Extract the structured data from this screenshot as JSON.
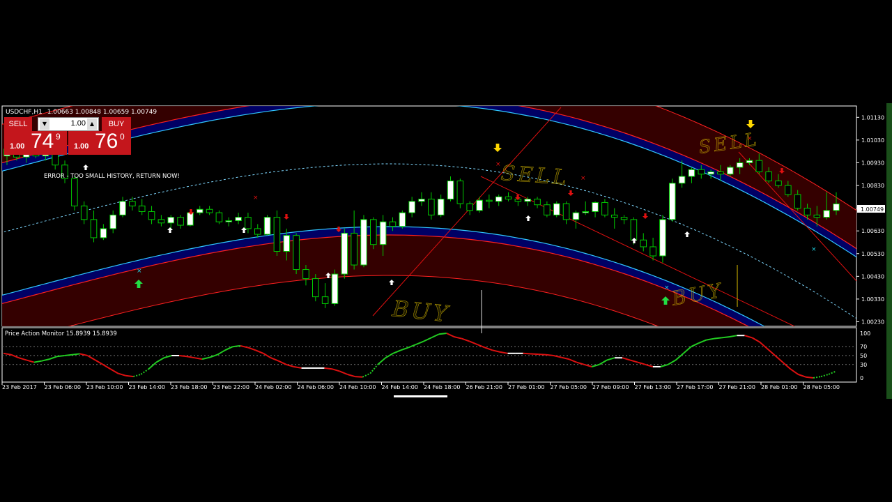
{
  "symbol_header": "USDCHF,H1",
  "ohlc_header": "1.00663 1.00848 1.00659 1.00749",
  "trade_panel": {
    "sell_label": "SELL",
    "buy_label": "BUY",
    "lots_value": "1.00",
    "sell_lots": "1.00",
    "sell_price_big": "74",
    "sell_price_sup": "9",
    "buy_lots": "1.00",
    "buy_price_big": "76",
    "buy_price_sup": "0"
  },
  "error_message": "ERROR - TOO SMALL HISTORY, RETURN NOW!",
  "indicator_header": "Price Action Monitor 15.8939 15.8939",
  "current_price_label": "1.00749",
  "annotations": {
    "sell_1": "SELL",
    "sell_2": "SELL",
    "buy_1": "BUY",
    "buy_2": "BUY"
  },
  "colors": {
    "background": "#000000",
    "bull_candle": "#ffffff",
    "bear_candle": "#000000",
    "candle_outline": "#00cc00",
    "band_fill": "#3a0000",
    "band_red": "#ff2020",
    "band_blue": "#000070",
    "band_cyan": "#30c8ff",
    "osc_up": "#22cc22",
    "osc_down": "#dd1111",
    "handwriting": "#e0c000"
  },
  "chart_data": [
    {
      "type": "candlestick",
      "title": "USDCHF,H1",
      "y_ticks": [
        "1.01130",
        "1.01030",
        "1.00930",
        "1.00830",
        "1.00730",
        "1.00630",
        "1.00530",
        "1.00430",
        "1.00330",
        "1.00230"
      ],
      "ylim": [
        1.0021,
        1.0118
      ],
      "x_ticks": [
        "23 Feb 2017",
        "23 Feb 06:00",
        "23 Feb 10:00",
        "23 Feb 14:00",
        "23 Feb 18:00",
        "23 Feb 22:00",
        "24 Feb 02:00",
        "24 Feb 06:00",
        "24 Feb 10:00",
        "24 Feb 14:00",
        "24 Feb 18:00",
        "26 Feb 21:00",
        "27 Feb 01:00",
        "27 Feb 05:00",
        "27 Feb 09:00",
        "27 Feb 13:00",
        "27 Feb 17:00",
        "27 Feb 21:00",
        "28 Feb 01:00",
        "28 Feb 05:00"
      ],
      "candles": [
        {
          "o": 1.0096,
          "h": 1.0101,
          "l": 1.0092,
          "c": 1.0099
        },
        {
          "o": 1.0099,
          "h": 1.01,
          "l": 1.0094,
          "c": 1.00955
        },
        {
          "o": 1.00955,
          "h": 1.0099,
          "l": 1.0093,
          "c": 1.00975
        },
        {
          "o": 1.00975,
          "h": 1.00995,
          "l": 1.0095,
          "c": 1.0096
        },
        {
          "o": 1.0096,
          "h": 1.0099,
          "l": 1.0094,
          "c": 1.00975
        },
        {
          "o": 1.00975,
          "h": 1.0098,
          "l": 1.009,
          "c": 1.0092
        },
        {
          "o": 1.0092,
          "h": 1.0094,
          "l": 1.0084,
          "c": 1.0086
        },
        {
          "o": 1.0086,
          "h": 1.0087,
          "l": 1.0072,
          "c": 1.0074
        },
        {
          "o": 1.0074,
          "h": 1.0076,
          "l": 1.0066,
          "c": 1.0068
        },
        {
          "o": 1.0068,
          "h": 1.0072,
          "l": 1.0058,
          "c": 1.006
        },
        {
          "o": 1.006,
          "h": 1.0066,
          "l": 1.0059,
          "c": 1.0064
        },
        {
          "o": 1.0064,
          "h": 1.0072,
          "l": 1.0062,
          "c": 1.007
        },
        {
          "o": 1.007,
          "h": 1.0078,
          "l": 1.0069,
          "c": 1.0076
        },
        {
          "o": 1.0076,
          "h": 1.0078,
          "l": 1.0072,
          "c": 1.0074
        },
        {
          "o": 1.0074,
          "h": 1.0077,
          "l": 1.007,
          "c": 1.00715
        },
        {
          "o": 1.00715,
          "h": 1.0074,
          "l": 1.0066,
          "c": 1.0068
        },
        {
          "o": 1.0068,
          "h": 1.007,
          "l": 1.0065,
          "c": 1.00665
        },
        {
          "o": 1.00665,
          "h": 1.007,
          "l": 1.0064,
          "c": 1.0069
        },
        {
          "o": 1.0069,
          "h": 1.007,
          "l": 1.0064,
          "c": 1.00655
        },
        {
          "o": 1.00655,
          "h": 1.0072,
          "l": 1.0065,
          "c": 1.0071
        },
        {
          "o": 1.0071,
          "h": 1.0074,
          "l": 1.007,
          "c": 1.00725
        },
        {
          "o": 1.00725,
          "h": 1.0074,
          "l": 1.007,
          "c": 1.0071
        },
        {
          "o": 1.0071,
          "h": 1.0072,
          "l": 1.0066,
          "c": 1.0067
        },
        {
          "o": 1.0067,
          "h": 1.0069,
          "l": 1.0065,
          "c": 1.00675
        },
        {
          "o": 1.00675,
          "h": 1.0071,
          "l": 1.0066,
          "c": 1.0069
        },
        {
          "o": 1.0069,
          "h": 1.0071,
          "l": 1.0062,
          "c": 1.0064
        },
        {
          "o": 1.0064,
          "h": 1.0066,
          "l": 1.006,
          "c": 1.00615
        },
        {
          "o": 1.00615,
          "h": 1.007,
          "l": 1.0061,
          "c": 1.0069
        },
        {
          "o": 1.0069,
          "h": 1.0072,
          "l": 1.0052,
          "c": 1.0054
        },
        {
          "o": 1.0054,
          "h": 1.0064,
          "l": 1.005,
          "c": 1.0061
        },
        {
          "o": 1.0061,
          "h": 1.0062,
          "l": 1.0044,
          "c": 1.0046
        },
        {
          "o": 1.0046,
          "h": 1.0048,
          "l": 1.0039,
          "c": 1.0042
        },
        {
          "o": 1.0042,
          "h": 1.0044,
          "l": 1.0032,
          "c": 1.0034
        },
        {
          "o": 1.0034,
          "h": 1.004,
          "l": 1.0029,
          "c": 1.0031
        },
        {
          "o": 1.0031,
          "h": 1.0046,
          "l": 1.003,
          "c": 1.0044
        },
        {
          "o": 1.0044,
          "h": 1.0064,
          "l": 1.0042,
          "c": 1.0062
        },
        {
          "o": 1.0062,
          "h": 1.0072,
          "l": 1.0046,
          "c": 1.0048
        },
        {
          "o": 1.0048,
          "h": 1.007,
          "l": 1.0047,
          "c": 1.0068
        },
        {
          "o": 1.0068,
          "h": 1.0069,
          "l": 1.0055,
          "c": 1.0057
        },
        {
          "o": 1.0057,
          "h": 1.007,
          "l": 1.0052,
          "c": 1.0067
        },
        {
          "o": 1.0067,
          "h": 1.0069,
          "l": 1.0063,
          "c": 1.0065
        },
        {
          "o": 1.0065,
          "h": 1.0072,
          "l": 1.0064,
          "c": 1.0071
        },
        {
          "o": 1.0071,
          "h": 1.0078,
          "l": 1.0069,
          "c": 1.0076
        },
        {
          "o": 1.0076,
          "h": 1.008,
          "l": 1.0074,
          "c": 1.0077
        },
        {
          "o": 1.0077,
          "h": 1.008,
          "l": 1.0068,
          "c": 1.007
        },
        {
          "o": 1.007,
          "h": 1.0079,
          "l": 1.0069,
          "c": 1.0077
        },
        {
          "o": 1.0077,
          "h": 1.0087,
          "l": 1.0076,
          "c": 1.0085
        },
        {
          "o": 1.0085,
          "h": 1.0086,
          "l": 1.0073,
          "c": 1.0075
        },
        {
          "o": 1.0075,
          "h": 1.0076,
          "l": 1.007,
          "c": 1.0072
        },
        {
          "o": 1.0072,
          "h": 1.0078,
          "l": 1.0071,
          "c": 1.00765
        },
        {
          "o": 1.00765,
          "h": 1.0079,
          "l": 1.0073,
          "c": 1.0076
        },
        {
          "o": 1.0076,
          "h": 1.0079,
          "l": 1.0074,
          "c": 1.0078
        },
        {
          "o": 1.0078,
          "h": 1.008,
          "l": 1.0076,
          "c": 1.0077
        },
        {
          "o": 1.0077,
          "h": 1.0079,
          "l": 1.0074,
          "c": 1.0076
        },
        {
          "o": 1.0076,
          "h": 1.0078,
          "l": 1.0074,
          "c": 1.0077
        },
        {
          "o": 1.0077,
          "h": 1.0078,
          "l": 1.0073,
          "c": 1.00745
        },
        {
          "o": 1.00745,
          "h": 1.0076,
          "l": 1.0069,
          "c": 1.007
        },
        {
          "o": 1.007,
          "h": 1.0076,
          "l": 1.0069,
          "c": 1.0075
        },
        {
          "o": 1.0075,
          "h": 1.0076,
          "l": 1.0066,
          "c": 1.0068
        },
        {
          "o": 1.0068,
          "h": 1.0072,
          "l": 1.0064,
          "c": 1.0071
        },
        {
          "o": 1.0071,
          "h": 1.0076,
          "l": 1.007,
          "c": 1.00715
        },
        {
          "o": 1.00715,
          "h": 1.0076,
          "l": 1.0069,
          "c": 1.00755
        },
        {
          "o": 1.00755,
          "h": 1.0077,
          "l": 1.0069,
          "c": 1.007
        },
        {
          "o": 1.007,
          "h": 1.0073,
          "l": 1.0064,
          "c": 1.0069
        },
        {
          "o": 1.0069,
          "h": 1.007,
          "l": 1.0066,
          "c": 1.0068
        },
        {
          "o": 1.0068,
          "h": 1.0069,
          "l": 1.0057,
          "c": 1.0059
        },
        {
          "o": 1.0059,
          "h": 1.0062,
          "l": 1.0054,
          "c": 1.0056
        },
        {
          "o": 1.0056,
          "h": 1.006,
          "l": 1.005,
          "c": 1.0052
        },
        {
          "o": 1.0052,
          "h": 1.007,
          "l": 1.0049,
          "c": 1.0068
        },
        {
          "o": 1.0068,
          "h": 1.0086,
          "l": 1.0067,
          "c": 1.0084
        },
        {
          "o": 1.0084,
          "h": 1.0094,
          "l": 1.0082,
          "c": 1.0087
        },
        {
          "o": 1.0087,
          "h": 1.0091,
          "l": 1.0084,
          "c": 1.009
        },
        {
          "o": 1.009,
          "h": 1.0092,
          "l": 1.0086,
          "c": 1.0088
        },
        {
          "o": 1.0088,
          "h": 1.009,
          "l": 1.0086,
          "c": 1.0089
        },
        {
          "o": 1.0089,
          "h": 1.0092,
          "l": 1.0085,
          "c": 1.0088
        },
        {
          "o": 1.0088,
          "h": 1.0092,
          "l": 1.0087,
          "c": 1.0091
        },
        {
          "o": 1.0091,
          "h": 1.0095,
          "l": 1.0088,
          "c": 1.0093
        },
        {
          "o": 1.0093,
          "h": 1.0095,
          "l": 1.0092,
          "c": 1.0094
        },
        {
          "o": 1.0094,
          "h": 1.0097,
          "l": 1.0088,
          "c": 1.0089
        },
        {
          "o": 1.0089,
          "h": 1.0091,
          "l": 1.0084,
          "c": 1.0085
        },
        {
          "o": 1.0085,
          "h": 1.0088,
          "l": 1.0082,
          "c": 1.0083
        },
        {
          "o": 1.0083,
          "h": 1.0085,
          "l": 1.0078,
          "c": 1.0079
        },
        {
          "o": 1.0079,
          "h": 1.0081,
          "l": 1.0072,
          "c": 1.0073
        },
        {
          "o": 1.0073,
          "h": 1.0075,
          "l": 1.0068,
          "c": 1.007
        },
        {
          "o": 1.007,
          "h": 1.0074,
          "l": 1.0065,
          "c": 1.0069
        },
        {
          "o": 1.0069,
          "h": 1.008,
          "l": 1.0068,
          "c": 1.0072
        },
        {
          "o": 1.0072,
          "h": 1.008,
          "l": 1.007,
          "c": 1.00749
        }
      ]
    },
    {
      "type": "line",
      "title": "Price Action Monitor",
      "y_ticks": [
        "100",
        "70",
        "50",
        "30",
        "0"
      ],
      "ylim": [
        0,
        100
      ],
      "values": [
        55,
        52,
        45,
        40,
        35,
        38,
        42,
        48,
        50,
        52,
        54,
        50,
        40,
        30,
        20,
        10,
        5,
        3,
        8,
        20,
        35,
        45,
        50,
        50,
        48,
        45,
        42,
        46,
        52,
        62,
        70,
        72,
        68,
        62,
        55,
        45,
        38,
        30,
        25,
        22,
        22,
        22,
        22,
        20,
        15,
        8,
        3,
        2,
        10,
        30,
        45,
        55,
        62,
        68,
        75,
        82,
        90,
        98,
        100,
        92,
        88,
        82,
        75,
        68,
        62,
        58,
        55,
        55,
        55,
        54,
        53,
        52,
        50,
        46,
        42,
        35,
        30,
        25,
        30,
        40,
        45,
        45,
        40,
        35,
        30,
        25,
        25,
        30,
        40,
        55,
        70,
        78,
        85,
        88,
        90,
        92,
        95,
        95,
        90,
        80,
        65,
        50,
        35,
        20,
        8,
        2,
        0,
        3,
        8,
        15
      ]
    }
  ]
}
